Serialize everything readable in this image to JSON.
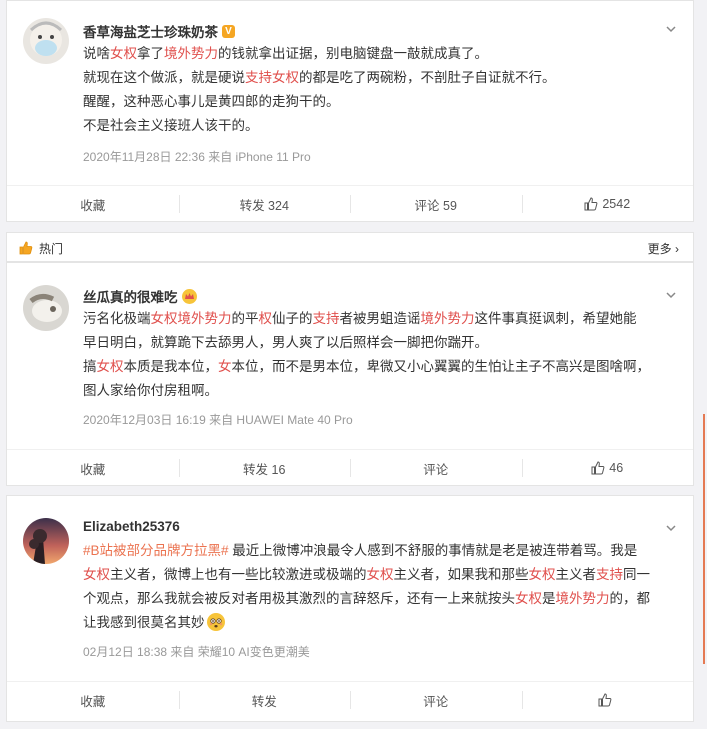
{
  "posts": [
    {
      "username": "香草海盐芝士珍珠奶茶",
      "badge": "V",
      "lines": [
        [
          {
            "t": "说啥",
            "h": false
          },
          {
            "t": "女权",
            "h": true
          },
          {
            "t": "拿了",
            "h": false
          },
          {
            "t": "境外势力",
            "h": true
          },
          {
            "t": "的钱就拿出证据，别电脑键盘一敲就成真了。",
            "h": false
          }
        ],
        [
          {
            "t": "就现在这个做派，就是硬说",
            "h": false
          },
          {
            "t": "支持女权",
            "h": true
          },
          {
            "t": "的都是吃了两碗粉，不剖肚子自证就不行。",
            "h": false
          }
        ],
        [
          {
            "t": "醒醒，这种恶心事儿是黄四郎的走狗干的。",
            "h": false
          }
        ],
        [
          {
            "t": "不是社会主义接班人该干的。",
            "h": false
          }
        ]
      ],
      "meta": "2020年11月28日 22:36  来自 iPhone 11 Pro",
      "actions": {
        "collect": "收藏",
        "repost": "转发 324",
        "comment": "评论 59",
        "like": "2542"
      }
    },
    {
      "username": "丝瓜真的很难吃",
      "lines": [
        [
          {
            "t": "污名化极端",
            "h": false
          },
          {
            "t": "女权境外势力",
            "h": true
          },
          {
            "t": "的平",
            "h": false
          },
          {
            "t": "权",
            "h": true
          },
          {
            "t": "仙子的",
            "h": false
          },
          {
            "t": "支持",
            "h": true
          },
          {
            "t": "者被男蛆造谣",
            "h": false
          },
          {
            "t": "境外势力",
            "h": true
          },
          {
            "t": "这件事真挺讽刺，希望她能",
            "h": false
          }
        ],
        [
          {
            "t": "早日明白，就算跪下去舔男人，男人爽了以后照样会一脚把你踹开。",
            "h": false
          }
        ],
        [
          {
            "t": "搞",
            "h": false
          },
          {
            "t": "女权",
            "h": true
          },
          {
            "t": "本质是我本位，",
            "h": false
          },
          {
            "t": "女",
            "h": true
          },
          {
            "t": "本位，而不是男本位，卑微又小心翼翼的生怕让主子不高兴是图啥啊，",
            "h": false
          }
        ],
        [
          {
            "t": "图人家给你付房租啊。",
            "h": false
          }
        ]
      ],
      "meta": "2020年12月03日 16:19  来自 HUAWEI Mate 40 Pro",
      "actions": {
        "collect": "收藏",
        "repost": "转发 16",
        "comment": "评论",
        "like": "46"
      }
    },
    {
      "username": "Elizabeth25376",
      "lines": [
        [
          {
            "t": "#B站被部分品牌方拉黑#",
            "h": false,
            "tag": true
          },
          {
            "t": " 最近上微博冲浪最令人感到不舒服的事情就是老是被连带着骂。我是",
            "h": false
          }
        ],
        [
          {
            "t": "女权",
            "h": true
          },
          {
            "t": "主义者，微博上也有一些比较激进或极端的",
            "h": false
          },
          {
            "t": "女权",
            "h": true
          },
          {
            "t": "主义者，如果我和那些",
            "h": false
          },
          {
            "t": "女权",
            "h": true
          },
          {
            "t": "主义者",
            "h": false
          },
          {
            "t": "支持",
            "h": true
          },
          {
            "t": "同一",
            "h": false
          }
        ],
        [
          {
            "t": "个观点，那么我就会被反对者用极其激烈的言辞怒斥，还有一上来就按头",
            "h": false
          },
          {
            "t": "女权",
            "h": true
          },
          {
            "t": "是",
            "h": false
          },
          {
            "t": "境外势力",
            "h": true
          },
          {
            "t": "的，都",
            "h": false
          }
        ],
        [
          {
            "t": "让我感到很莫名其妙",
            "h": false
          }
        ]
      ],
      "meta": "02月12日 18:38  来自 荣耀10 AI变色更潮美",
      "actions": {
        "collect": "收藏",
        "repost": "转发",
        "comment": "评论",
        "like": ""
      }
    }
  ],
  "hot": {
    "label": "热门",
    "more": "更多"
  },
  "icons": {
    "like": "thumbs-up-icon",
    "chevron": "chevron-down-icon",
    "hot": "like-hand-icon",
    "more": "chevron-right-icon",
    "emoji": "flushed-face-emoji"
  },
  "colors": {
    "highlight": "#e0504d",
    "hashtag": "#eb7350",
    "meta": "#999999",
    "scroll_accent": "#e57a53"
  }
}
